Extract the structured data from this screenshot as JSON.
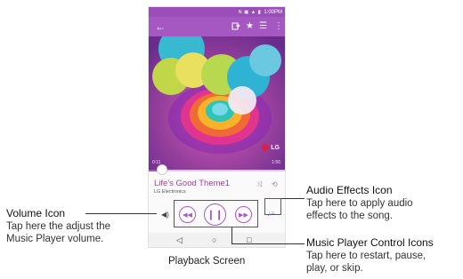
{
  "status_bar": {
    "icons": "N ▣ ▲ ▮",
    "time": "1:00PM"
  },
  "toolbar": {
    "back_icon": "arrow-left-icon",
    "share_icon": "export-icon",
    "favorite_icon": "star-icon",
    "playlist_icon": "playlist-icon",
    "more_icon": "overflow-menu-icon"
  },
  "album_art": {
    "brand": "LG"
  },
  "player": {
    "elapsed": "0:11",
    "duration": "1:56",
    "progress": 0.1,
    "song_title": "Life's Good Theme1",
    "artist": "LG Electronics"
  },
  "controls": {
    "previous_icon": "rewind-icon",
    "pause_icon": "pause-icon",
    "next_icon": "fast-forward-icon",
    "volume_icon": "volume-icon",
    "effects_icon": "audio-effects-icon",
    "shuffle_icon": "shuffle-icon",
    "repeat_icon": "repeat-icon"
  },
  "nav_bar": {
    "back": "back-triangle-icon",
    "home": "home-circle-icon",
    "recents": "recents-square-icon"
  },
  "annotations": {
    "volume": {
      "title": "Volume Icon",
      "desc_line1": "Tap here the adjust the",
      "desc_line2": "Music Player volume."
    },
    "audio_effects": {
      "title": "Audio Effects Icon",
      "desc_line1": "Tap here to apply audio",
      "desc_line2": "effects to the song."
    },
    "controls": {
      "title": "Music Player Control Icons",
      "desc_line1": "Tap here to restart, pause,",
      "desc_line2": "play, or skip."
    }
  },
  "caption": "Playback Screen",
  "colors": {
    "accent": "#a658c2",
    "highlight": "#9c2c8e",
    "title_text": "#a0429f"
  }
}
